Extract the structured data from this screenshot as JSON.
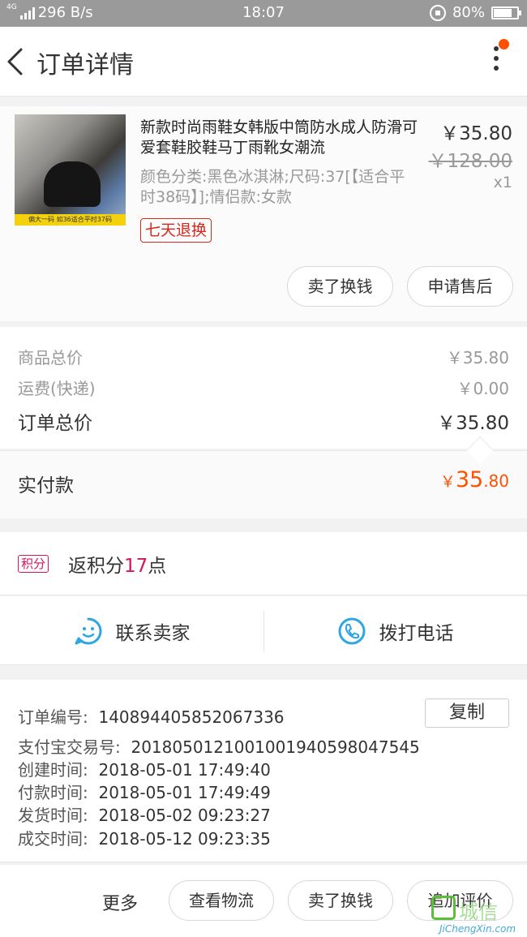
{
  "status_bar": {
    "network_type": "4G",
    "speed": "296 B/s",
    "time": "18:07",
    "battery_text": "80%",
    "battery_level": 0.8
  },
  "header": {
    "title": "订单详情"
  },
  "product": {
    "title": "新款时尚雨鞋女韩版中筒防水成人防滑可爱套鞋胶鞋马丁雨靴女潮流",
    "spec": "颜色分类:黑色冰淇淋;尺码:37[【适合平时38码】];情侣款:女款",
    "price": "￥35.80",
    "original_price": "￥128.00",
    "quantity": "x1",
    "return_badge": "七天退换",
    "image_banner": "偏大一码  如36适合平时37码",
    "sell_button": "卖了换钱",
    "after_sale_button": "申请售后"
  },
  "price_summary": {
    "goods_label": "商品总价",
    "goods_value": "￥35.80",
    "shipping_label": "运费(快递)",
    "shipping_value": "￥0.00",
    "total_label": "订单总价",
    "total_value": "￥35.80",
    "paid_label": "实付款",
    "paid_yen": "￥",
    "paid_int": "35",
    "paid_dec": ".80"
  },
  "points": {
    "badge": "积分",
    "prefix": "返积分",
    "count": "17",
    "suffix": "点"
  },
  "contact": {
    "seller_label": "联系卖家",
    "phone_label": "拨打电话"
  },
  "order_info": {
    "copy_button": "复制",
    "rows": [
      {
        "label": "订单编号:",
        "value": "140894405852067336"
      },
      {
        "label": "支付宝交易号:",
        "value": "2018050121001001940598047545"
      },
      {
        "label": "创建时间:",
        "value": "2018-05-01 17:49:40"
      },
      {
        "label": "付款时间:",
        "value": "2018-05-01 17:49:49"
      },
      {
        "label": "发货时间:",
        "value": "2018-05-02 09:23:27"
      },
      {
        "label": "成交时间:",
        "value": "2018-05-12 09:23:35"
      }
    ]
  },
  "bottom_bar": {
    "more_label": "更多",
    "logistics_button": "查看物流",
    "sell_button": "卖了换钱",
    "review_button": "追加评价"
  },
  "watermark": {
    "text": "城信",
    "url": "JiChengXin.com"
  },
  "colors": {
    "accent_orange": "#ff5000",
    "return_red": "#d9261c",
    "points_pink": "#d4145a",
    "contact_blue": "#2da6e3",
    "status_bar": "#9a9a9a"
  }
}
